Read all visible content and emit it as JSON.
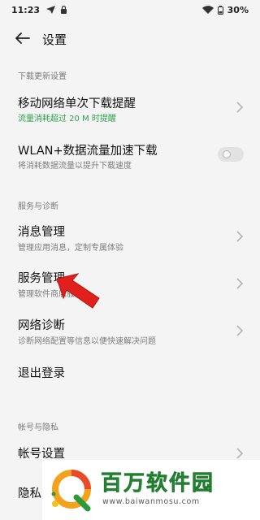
{
  "status_bar": {
    "time": "11:23",
    "battery": "30%"
  },
  "app_bar": {
    "title": "设置"
  },
  "sections": {
    "download": {
      "header": "下载更新设置",
      "mobile_reminder": {
        "title": "移动网络单次下载提醒",
        "subtitle": "流量消耗超过 20 M 时提醒"
      },
      "wlan_boost": {
        "title": "WLAN+数据流量加速下载",
        "subtitle": "将消耗数据流量以提升下载速度",
        "toggle_on": false
      }
    },
    "service": {
      "header": "服务与诊断",
      "message_mgmt": {
        "title": "消息管理",
        "subtitle": "管理应用消息，定制专属体验"
      },
      "service_mgmt": {
        "title": "服务管理",
        "subtitle": "管理软件商店服务"
      },
      "network_diag": {
        "title": "网络诊断",
        "subtitle": "诊断网络配置等信息以便快速解决问题"
      },
      "logout": {
        "title": "退出登录"
      }
    },
    "account": {
      "header": "帐号与隐私",
      "account_settings": {
        "title": "帐号设置"
      },
      "privacy": {
        "title": "隐私"
      }
    }
  },
  "watermark": {
    "title": "百万软件园",
    "url": "www.baiwanmosu.com"
  },
  "colors": {
    "accent_green": "#2ea24c",
    "pointer_red": "#e0201c",
    "background": "#f4f4f4"
  }
}
